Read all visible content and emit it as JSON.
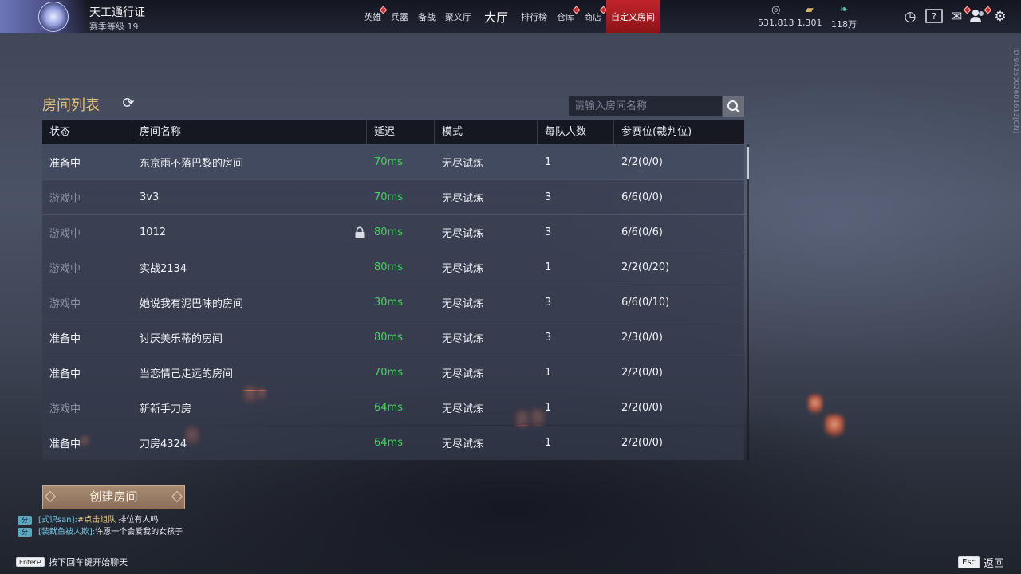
{
  "topbar": {
    "pass_title": "天工通行证",
    "pass_level": "赛季等级 19",
    "nav": [
      {
        "label": "英雄",
        "dot": true
      },
      {
        "label": "兵器",
        "dot": false
      },
      {
        "label": "备战",
        "dot": false
      },
      {
        "label": "聚义厅",
        "dot": false
      },
      {
        "label": "大厅",
        "dot": false
      },
      {
        "label": "排行榜",
        "dot": false
      },
      {
        "label": "仓库",
        "dot": true
      },
      {
        "label": "商店",
        "dot": true
      },
      {
        "label": "自定义房间",
        "dot": false
      }
    ],
    "currencies": [
      {
        "icon": "coin-icon",
        "value": "531,813"
      },
      {
        "icon": "gold-bar-icon",
        "value": "1,301"
      },
      {
        "icon": "feather-icon",
        "value": "118万"
      }
    ],
    "side_id": "ID:9425002601613[CN]"
  },
  "room_list": {
    "title": "房间列表",
    "search_placeholder": "请输入房间名称",
    "columns": [
      "状态",
      "房间名称",
      "延迟",
      "模式",
      "每队人数",
      "参赛位(裁判位)"
    ],
    "rows": [
      {
        "status": "准备中",
        "name": "东京雨不落巴黎的房间",
        "ping": "70ms",
        "mode": "无尽试炼",
        "team_size": "1",
        "slots": "2/2(0/0)",
        "locked": false
      },
      {
        "status": "游戏中",
        "name": "3v3",
        "ping": "70ms",
        "mode": "无尽试炼",
        "team_size": "3",
        "slots": "6/6(0/0)",
        "locked": false
      },
      {
        "status": "游戏中",
        "name": "1012",
        "ping": "80ms",
        "mode": "无尽试炼",
        "team_size": "3",
        "slots": "6/6(0/6)",
        "locked": true
      },
      {
        "status": "游戏中",
        "name": "实战2134",
        "ping": "80ms",
        "mode": "无尽试炼",
        "team_size": "1",
        "slots": "2/2(0/20)",
        "locked": false
      },
      {
        "status": "游戏中",
        "name": "她说我有泥巴味的房间",
        "ping": "30ms",
        "mode": "无尽试炼",
        "team_size": "3",
        "slots": "6/6(0/10)",
        "locked": false
      },
      {
        "status": "准备中",
        "name": "讨厌美乐蒂的房间",
        "ping": "80ms",
        "mode": "无尽试炼",
        "team_size": "3",
        "slots": "2/3(0/0)",
        "locked": false
      },
      {
        "status": "准备中",
        "name": "当恋情己走远的房间",
        "ping": "70ms",
        "mode": "无尽试炼",
        "team_size": "1",
        "slots": "2/2(0/0)",
        "locked": false
      },
      {
        "status": "游戏中",
        "name": "新新手刀房",
        "ping": "64ms",
        "mode": "无尽试炼",
        "team_size": "1",
        "slots": "2/2(0/0)",
        "locked": false
      },
      {
        "status": "准备中",
        "name": "刀房4324",
        "ping": "64ms",
        "mode": "无尽试炼",
        "team_size": "1",
        "slots": "2/2(0/0)",
        "locked": false
      }
    ],
    "create_button": "创建房间"
  },
  "chat": {
    "messages": [
      {
        "tag": "分",
        "user": "[式识san]:",
        "link": "#点击组队",
        "text": " 排位有人吗"
      },
      {
        "tag": "分",
        "user": "[装鱿鱼被人欺]:",
        "link": "",
        "text": "许愿一个会爱我的女孩子"
      }
    ],
    "enter_key": "Enter↵",
    "enter_hint": "按下回车键开始聊天"
  },
  "footer": {
    "esc_key": "Esc",
    "back_label": "返回"
  },
  "colors": {
    "accent_gold": "#e4c17a",
    "ping_green": "#46d35d",
    "active_tab_red": "#c2252b",
    "badge_red": "#d52a2a"
  }
}
